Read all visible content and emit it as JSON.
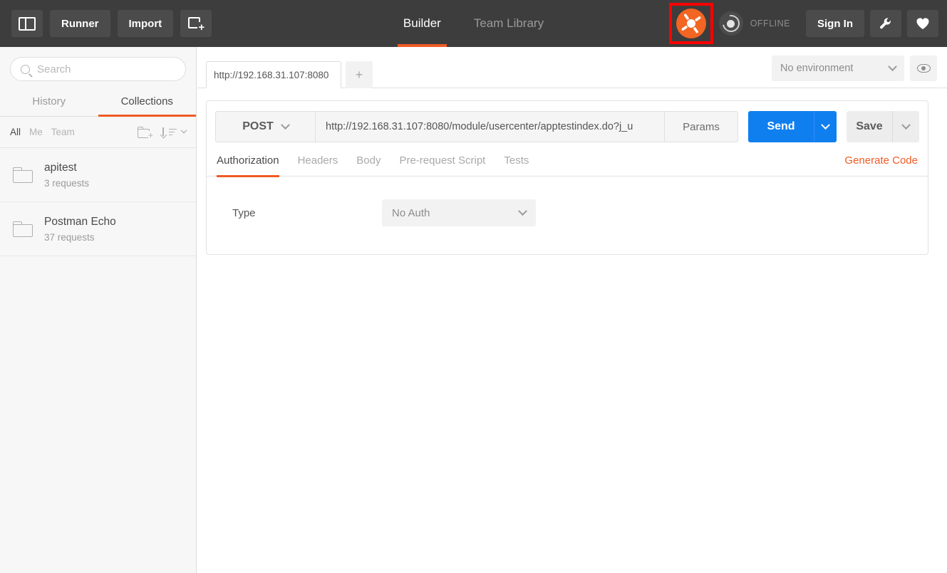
{
  "topbar": {
    "sidepanel_icon": "sidepanel-toggle-icon",
    "runner_label": "Runner",
    "import_label": "Import",
    "newtab_icon": "new-window-icon",
    "modes": [
      {
        "label": "Builder",
        "active": true
      },
      {
        "label": "Team Library",
        "active": false
      }
    ],
    "logo_icon": "postman-logo-icon",
    "logo_highlight_color": "#ff0000",
    "logo_color": "#f26522",
    "sync_icon": "sync-offline-icon",
    "status_label": "OFFLINE",
    "signin_label": "Sign In",
    "wrench_icon": "wrench-icon",
    "heart_icon": "heart-icon",
    "background_color": "#3d3d3d",
    "accent_color": "#ef5b25"
  },
  "sidebar": {
    "search": {
      "placeholder": "Search",
      "value": "",
      "icon": "search-icon"
    },
    "tabs": [
      {
        "label": "History",
        "active": false
      },
      {
        "label": "Collections",
        "active": true
      }
    ],
    "filters": [
      {
        "label": "All",
        "active": true
      },
      {
        "label": "Me",
        "active": false
      },
      {
        "label": "Team",
        "active": false
      }
    ],
    "new_folder_icon": "new-folder-icon",
    "sort_icon": "sort-icon",
    "collections": [
      {
        "name": "apitest",
        "count": "3 requests",
        "icon": "folder-icon"
      },
      {
        "name": "Postman Echo",
        "count": "37 requests",
        "icon": "folder-icon"
      }
    ]
  },
  "main": {
    "request_tabs": [
      {
        "label": "http://192.168.31.107:8080",
        "active": true
      }
    ],
    "add_tab_icon": "plus-icon",
    "environment": {
      "selected": "No environment",
      "chevron_icon": "chevron-down-icon",
      "eye_icon": "eye-icon"
    },
    "request": {
      "method": "POST",
      "method_chevron_icon": "chevron-down-icon",
      "url": "http://192.168.31.107:8080/module/usercenter/apptestindex.do?j_u",
      "params_label": "Params",
      "send_label": "Send",
      "send_chevron_icon": "chevron-down-icon",
      "send_color": "#0f7ff0",
      "save_label": "Save",
      "save_chevron_icon": "chevron-down-icon"
    },
    "sub_tabs": [
      {
        "label": "Authorization",
        "active": true
      },
      {
        "label": "Headers",
        "active": false
      },
      {
        "label": "Body",
        "active": false
      },
      {
        "label": "Pre-request Script",
        "active": false
      },
      {
        "label": "Tests",
        "active": false
      }
    ],
    "generate_code_label": "Generate Code",
    "auth": {
      "type_label": "Type",
      "type_value": "No Auth",
      "chevron_icon": "chevron-down-icon"
    }
  }
}
